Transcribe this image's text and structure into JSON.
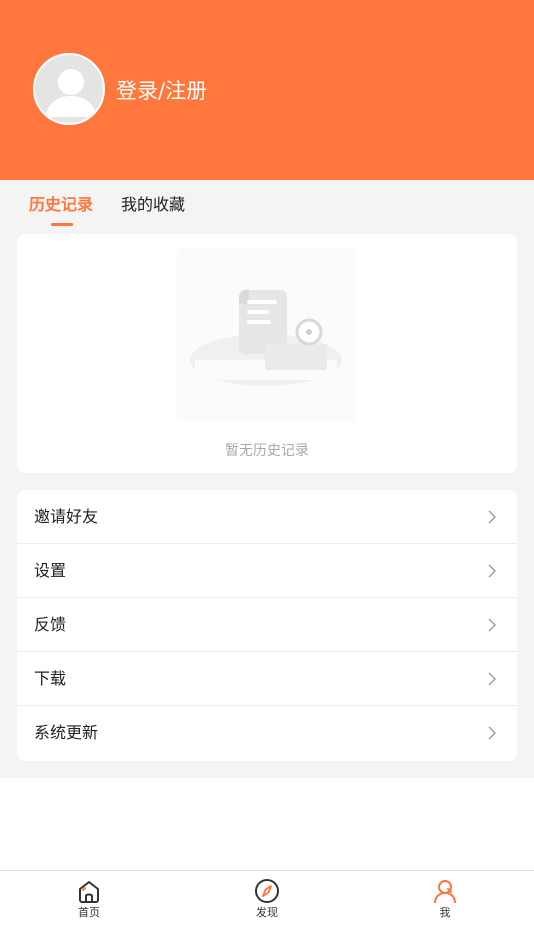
{
  "header": {
    "login_label": "登录/注册"
  },
  "tabs": [
    {
      "label": "历史记录"
    },
    {
      "label": "我的收藏"
    }
  ],
  "history": {
    "empty_text": "暂无历史记录"
  },
  "menu": [
    {
      "label": "邀请好友"
    },
    {
      "label": "设置"
    },
    {
      "label": "反馈"
    },
    {
      "label": "下载"
    },
    {
      "label": "系统更新"
    }
  ],
  "tabbar": [
    {
      "label": "首页",
      "icon": "home-icon"
    },
    {
      "label": "发现",
      "icon": "compass-icon"
    },
    {
      "label": "我",
      "icon": "profile-icon"
    }
  ],
  "colors": {
    "accent": "#FF773D",
    "background": "#F4F4F4"
  }
}
